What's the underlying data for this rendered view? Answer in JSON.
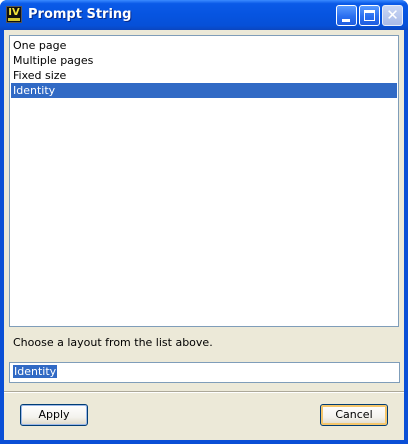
{
  "window": {
    "title": "Prompt String",
    "app_icon_glyph": "IV",
    "controls": {
      "minimize": "minimize-icon",
      "maximize": "maximize-icon",
      "close": "close-icon",
      "close_glyph": "✕"
    }
  },
  "list": {
    "items": [
      {
        "label": "One page",
        "selected": false
      },
      {
        "label": "Multiple pages",
        "selected": false
      },
      {
        "label": "Fixed size",
        "selected": false
      },
      {
        "label": "Identity",
        "selected": true
      }
    ]
  },
  "hint_text": "Choose a layout from the list above.",
  "input": {
    "value": "Identity"
  },
  "buttons": {
    "apply": "Apply",
    "cancel": "Cancel"
  },
  "colors": {
    "title_bar": "#0654e0",
    "selection": "#316ac5",
    "dialog_bg": "#ece9d8"
  }
}
